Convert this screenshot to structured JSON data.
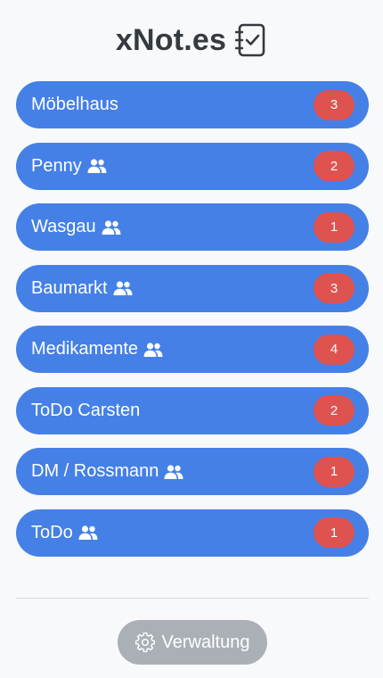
{
  "app": {
    "title": "xNot.es",
    "title_icon": "checklist-notebook-icon"
  },
  "lists": [
    {
      "name": "Möbelhaus",
      "shared": false,
      "count": "3"
    },
    {
      "name": "Penny",
      "shared": true,
      "count": "2"
    },
    {
      "name": "Wasgau",
      "shared": true,
      "count": "1"
    },
    {
      "name": "Baumarkt",
      "shared": true,
      "count": "3"
    },
    {
      "name": "Medikamente",
      "shared": true,
      "count": "4"
    },
    {
      "name": "ToDo Carsten",
      "shared": false,
      "count": "2"
    },
    {
      "name": "DM / Rossmann",
      "shared": true,
      "count": "1"
    },
    {
      "name": "ToDo",
      "shared": true,
      "count": "1"
    }
  ],
  "footer": {
    "manage_label": "Verwaltung",
    "manage_icon": "gear-icon"
  },
  "colors": {
    "background": "#f8f9fa",
    "list_item": "#4580e6",
    "badge": "#de5350",
    "manage_button": "#aab0b6",
    "title": "#343a40"
  }
}
